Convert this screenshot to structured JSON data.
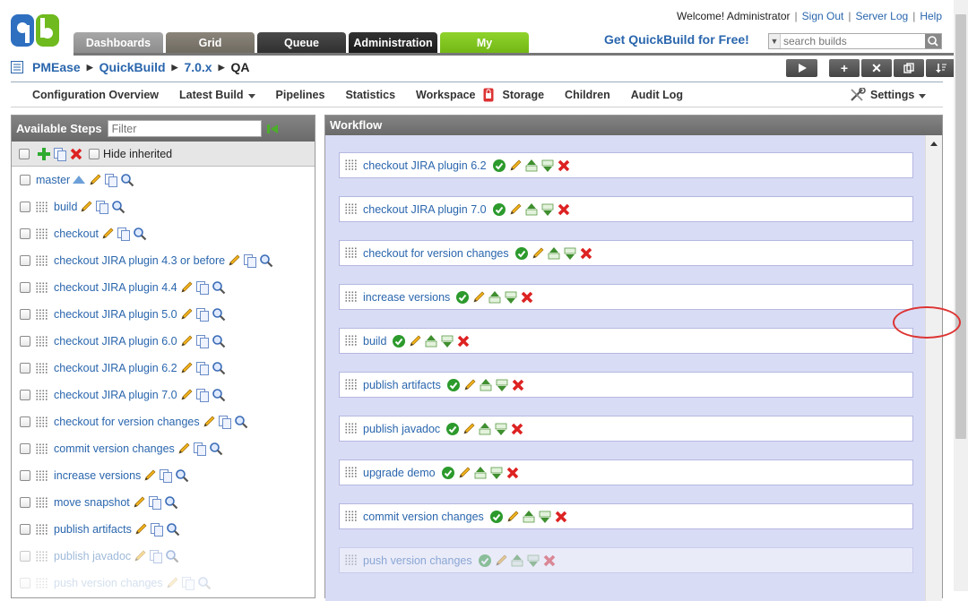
{
  "header": {
    "welcome_text": "Welcome! Administrator",
    "user_links": [
      "Sign Out",
      "Server Log",
      "Help"
    ],
    "main_tabs": [
      "Dashboards",
      "Grid",
      "Queue",
      "Administration",
      "My"
    ],
    "promo": "Get QuickBuild for Free!",
    "search_placeholder": "search builds"
  },
  "breadcrumb": [
    "PMEase",
    "QuickBuild",
    "7.0.x",
    "QA"
  ],
  "subnav": [
    "Configuration Overview",
    "Latest Build",
    "Pipelines",
    "Statistics",
    "Workspace",
    "Storage",
    "Children",
    "Audit Log",
    "Settings"
  ],
  "left_panel": {
    "title": "Available Steps",
    "filter_placeholder": "Filter",
    "hide_inherited_label": "Hide inherited",
    "steps": [
      "master",
      "build",
      "checkout",
      "checkout JIRA plugin 4.3 or before",
      "checkout JIRA plugin 4.4",
      "checkout JIRA plugin 5.0",
      "checkout JIRA plugin 6.0",
      "checkout JIRA plugin 6.2",
      "checkout JIRA plugin 7.0",
      "checkout for version changes",
      "commit version changes",
      "increase versions",
      "move snapshot",
      "publish artifacts",
      "publish javadoc",
      "push version changes"
    ]
  },
  "workflow": {
    "title": "Workflow",
    "steps": [
      "checkout JIRA plugin 6.2",
      "checkout JIRA plugin 7.0",
      "checkout for version changes",
      "increase versions",
      "build",
      "publish artifacts",
      "publish javadoc",
      "upgrade demo",
      "commit version changes",
      "push version changes"
    ]
  },
  "colors": {
    "link": "#2a66ad",
    "my_tab": "#7cc41e",
    "workflow_bg": "#d9dcf5",
    "highlight": "#dd3333"
  }
}
